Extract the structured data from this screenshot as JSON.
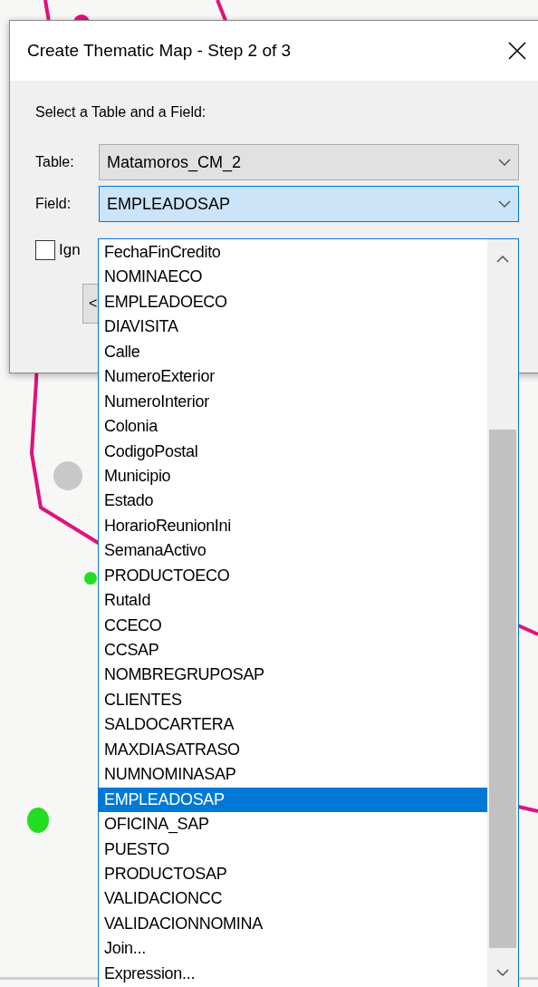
{
  "dialog": {
    "title": "Create Thematic Map - Step 2 of 3",
    "prompt": "Select a Table and a Field:",
    "table": {
      "label": "Table:",
      "value": "Matamoros_CM_2"
    },
    "field": {
      "label": "Field:",
      "value": "EMPLEADOSAP",
      "expanded": true
    },
    "checkbox": {
      "label": "Ign",
      "checked": false
    },
    "back_button": {
      "label": "<"
    }
  },
  "dropdown": {
    "items": [
      {
        "label": "FechaFinCredito",
        "selected": false
      },
      {
        "label": "NOMINAECO",
        "selected": false
      },
      {
        "label": "EMPLEADOECO",
        "selected": false
      },
      {
        "label": "DIAVISITA",
        "selected": false
      },
      {
        "label": "Calle",
        "selected": false
      },
      {
        "label": "NumeroExterior",
        "selected": false
      },
      {
        "label": "NumeroInterior",
        "selected": false
      },
      {
        "label": "Colonia",
        "selected": false
      },
      {
        "label": "CodigoPostal",
        "selected": false
      },
      {
        "label": "Municipio",
        "selected": false
      },
      {
        "label": "Estado",
        "selected": false
      },
      {
        "label": "HorarioReunionIni",
        "selected": false
      },
      {
        "label": "SemanaActivo",
        "selected": false
      },
      {
        "label": "PRODUCTOECO",
        "selected": false
      },
      {
        "label": "RutaId",
        "selected": false
      },
      {
        "label": "CCECO",
        "selected": false
      },
      {
        "label": "CCSAP",
        "selected": false
      },
      {
        "label": "NOMBREGRUPOSAP",
        "selected": false
      },
      {
        "label": "CLIENTES",
        "selected": false
      },
      {
        "label": "SALDOCARTERA",
        "selected": false
      },
      {
        "label": "MAXDIASATRASO",
        "selected": false
      },
      {
        "label": "NUMNOMINASAP",
        "selected": false
      },
      {
        "label": "EMPLEADOSAP",
        "selected": true
      },
      {
        "label": "OFICINA_SAP",
        "selected": false
      },
      {
        "label": "PUESTO",
        "selected": false
      },
      {
        "label": "PRODUCTOSAP",
        "selected": false
      },
      {
        "label": "VALIDACIONCC",
        "selected": false
      },
      {
        "label": "VALIDACIONNOMINA",
        "selected": false
      },
      {
        "label": "Join...",
        "selected": false
      },
      {
        "label": "Expression...",
        "selected": false
      }
    ]
  }
}
